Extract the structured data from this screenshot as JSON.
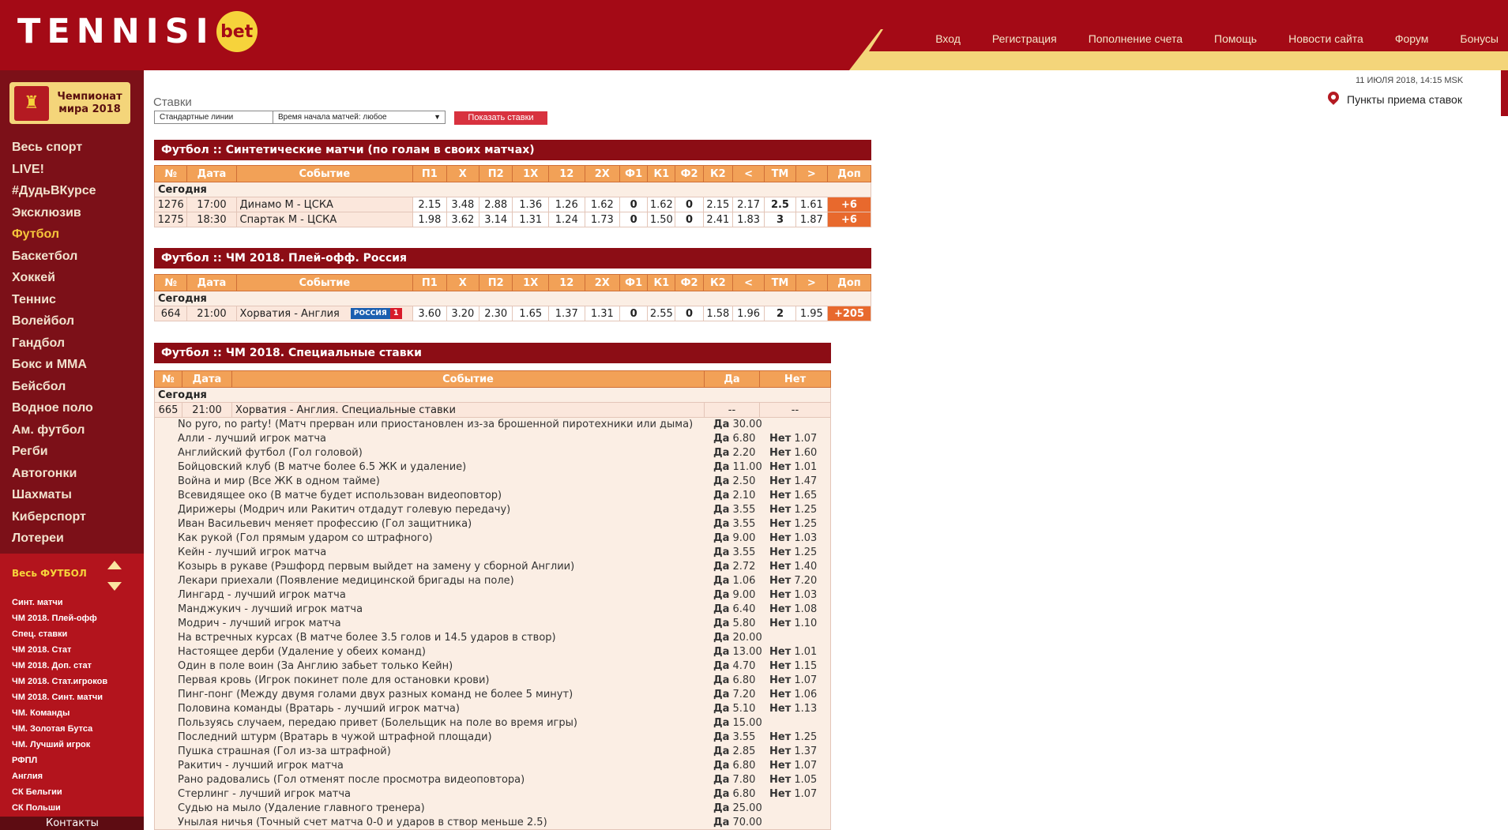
{
  "brand": {
    "name": "TENNISI",
    "badge": "bet"
  },
  "nav": [
    "Вход",
    "Регистрация",
    "Пополнение счета",
    "Помощь",
    "Новости сайта",
    "Форум",
    "Бонусы"
  ],
  "banner": {
    "line1": "Чемпионат",
    "line2": "мира 2018"
  },
  "sports": [
    "Весь спорт",
    "LIVE!",
    "#ДудьВКурсе",
    "Эксклюзив",
    "Футбол",
    "Баскетбол",
    "Хоккей",
    "Теннис",
    "Волейбол",
    "Гандбол",
    "Бокс и ММА",
    "Бейсбол",
    "Водное поло",
    "Ам. футбол",
    "Регби",
    "Автогонки",
    "Шахматы",
    "Киберспорт",
    "Лотереи"
  ],
  "active_sport_index": 4,
  "football_menu": {
    "title": "Весь ФУТБОЛ",
    "items": [
      "Синт. матчи",
      "ЧМ 2018. Плей-офф",
      "Спец. ставки",
      "ЧМ 2018. Стат",
      "ЧМ 2018. Доп. стат",
      "ЧМ 2018. Стат.игроков",
      "ЧМ 2018. Синт. матчи",
      "ЧМ. Команды",
      "ЧМ. Золотая Бутса",
      "ЧМ. Лучший игрок",
      "РФПЛ",
      "Англия",
      "СК Бельгии",
      "СК Польши"
    ]
  },
  "contacts": "Контакты",
  "stavki": {
    "title": "Ставки",
    "line_select": "Стандартные линии",
    "time_select": "Время начала матчей: любое",
    "show_button": "Показать ставки"
  },
  "datetime": "11 ИЮЛЯ 2018, 14:15 MSK",
  "points_label": "Пункты приема ставок",
  "odds_headers": [
    "№",
    "Дата",
    "Событие",
    "П1",
    "Х",
    "П2",
    "1Х",
    "12",
    "2Х",
    "Ф1",
    "К1",
    "Ф2",
    "К2",
    "<",
    "ТМ",
    ">",
    "Доп"
  ],
  "today_label": "Сегодня",
  "section1": {
    "title": "Футбол :: Синтетические матчи (по голам в своих матчах)",
    "rows": [
      [
        "1276",
        "17:00",
        "Динамо М - ЦСКА",
        "2.15",
        "3.48",
        "2.88",
        "1.36",
        "1.26",
        "1.62",
        "0",
        "1.62",
        "0",
        "2.15",
        "2.17",
        "2.5",
        "1.61",
        "+6"
      ],
      [
        "1275",
        "18:30",
        "Спартак М - ЦСКА",
        "1.98",
        "3.62",
        "3.14",
        "1.31",
        "1.24",
        "1.73",
        "0",
        "1.50",
        "0",
        "2.41",
        "1.83",
        "3",
        "1.87",
        "+6"
      ]
    ]
  },
  "section2": {
    "title": "Футбол :: ЧМ 2018. Плей-офф. Россия",
    "tv_channel": "РОССИЯ",
    "tv_number": "1",
    "rows": [
      [
        "664",
        "21:00",
        "Хорватия - Англия",
        "3.60",
        "3.20",
        "2.30",
        "1.65",
        "1.37",
        "1.31",
        "0",
        "2.55",
        "0",
        "1.58",
        "1.96",
        "2",
        "1.95",
        "+205"
      ]
    ]
  },
  "section3": {
    "title": "Футбол :: ЧМ 2018. Специальные ставки",
    "headers": [
      "№",
      "Дата",
      "Событие",
      "Да",
      "Нет"
    ],
    "event": {
      "num": "665",
      "time": "21:00",
      "name": "Хорватия - Англия. Специальные ставки",
      "da": "--",
      "net": "--"
    },
    "da_label": "Да",
    "net_label": "Нет",
    "bets": [
      {
        "name": "No pyro, no party! (Матч прерван или приостановлен из-за брошенной пиротехники или дыма)",
        "da": "30.00",
        "net": ""
      },
      {
        "name": "Алли - лучший игрок матча",
        "da": "6.80",
        "net": "1.07"
      },
      {
        "name": "Английский футбол (Гол головой)",
        "da": "2.20",
        "net": "1.60"
      },
      {
        "name": "Бойцовский клуб (В матче более 6.5 ЖК и удаление)",
        "da": "11.00",
        "net": "1.01"
      },
      {
        "name": "Война и мир (Все ЖК в одном тайме)",
        "da": "2.50",
        "net": "1.47"
      },
      {
        "name": "Всевидящее око (В матче будет использован видеоповтор)",
        "da": "2.10",
        "net": "1.65"
      },
      {
        "name": "Дирижеры (Модрич или Ракитич отдадут голевую передачу)",
        "da": "3.55",
        "net": "1.25"
      },
      {
        "name": "Иван Васильевич меняет профессию (Гол защитника)",
        "da": "3.55",
        "net": "1.25"
      },
      {
        "name": "Как рукой (Гол прямым ударом со штрафного)",
        "da": "9.00",
        "net": "1.03"
      },
      {
        "name": "Кейн - лучший игрок матча",
        "da": "3.55",
        "net": "1.25"
      },
      {
        "name": "Козырь в рукаве (Рэшфорд первым выйдет на замену у сборной Англии)",
        "da": "2.72",
        "net": "1.40"
      },
      {
        "name": "Лекари приехали (Появление медицинской бригады на поле)",
        "da": "1.06",
        "net": "7.20"
      },
      {
        "name": "Лингард - лучший игрок матча",
        "da": "9.00",
        "net": "1.03"
      },
      {
        "name": "Манджукич - лучший игрок матча",
        "da": "6.40",
        "net": "1.08"
      },
      {
        "name": "Модрич - лучший игрок матча",
        "da": "5.80",
        "net": "1.10"
      },
      {
        "name": "На встречных курсах (В матче более 3.5 голов и 14.5 ударов в створ)",
        "da": "20.00",
        "net": ""
      },
      {
        "name": "Настоящее дерби (Удаление у обеих команд)",
        "da": "13.00",
        "net": "1.01"
      },
      {
        "name": "Один в поле воин (За Англию забьет только Кейн)",
        "da": "4.70",
        "net": "1.15"
      },
      {
        "name": "Первая кровь (Игрок покинет поле для остановки крови)",
        "da": "6.80",
        "net": "1.07"
      },
      {
        "name": "Пинг-понг (Между двумя голами двух разных команд не более 5 минут)",
        "da": "7.20",
        "net": "1.06"
      },
      {
        "name": "Половина команды (Вратарь - лучший игрок матча)",
        "da": "5.10",
        "net": "1.13"
      },
      {
        "name": "Пользуясь случаем, передаю привет (Болельщик на поле во время игры)",
        "da": "15.00",
        "net": ""
      },
      {
        "name": "Последний штурм (Вратарь в чужой штрафной площади)",
        "da": "3.55",
        "net": "1.25"
      },
      {
        "name": "Пушка страшная (Гол из-за штрафной)",
        "da": "2.85",
        "net": "1.37"
      },
      {
        "name": "Ракитич - лучший игрок матча",
        "da": "6.80",
        "net": "1.07"
      },
      {
        "name": "Рано радовались (Гол отменят после просмотра видеоповтора)",
        "da": "7.80",
        "net": "1.05"
      },
      {
        "name": "Стерлинг - лучший игрок матча",
        "da": "6.80",
        "net": "1.07"
      },
      {
        "name": "Судью на мыло (Удаление главного тренера)",
        "da": "25.00",
        "net": ""
      },
      {
        "name": "Унылая ничья (Точный счет матча 0-0 и ударов в створ меньше 2.5)",
        "da": "70.00",
        "net": ""
      }
    ]
  }
}
